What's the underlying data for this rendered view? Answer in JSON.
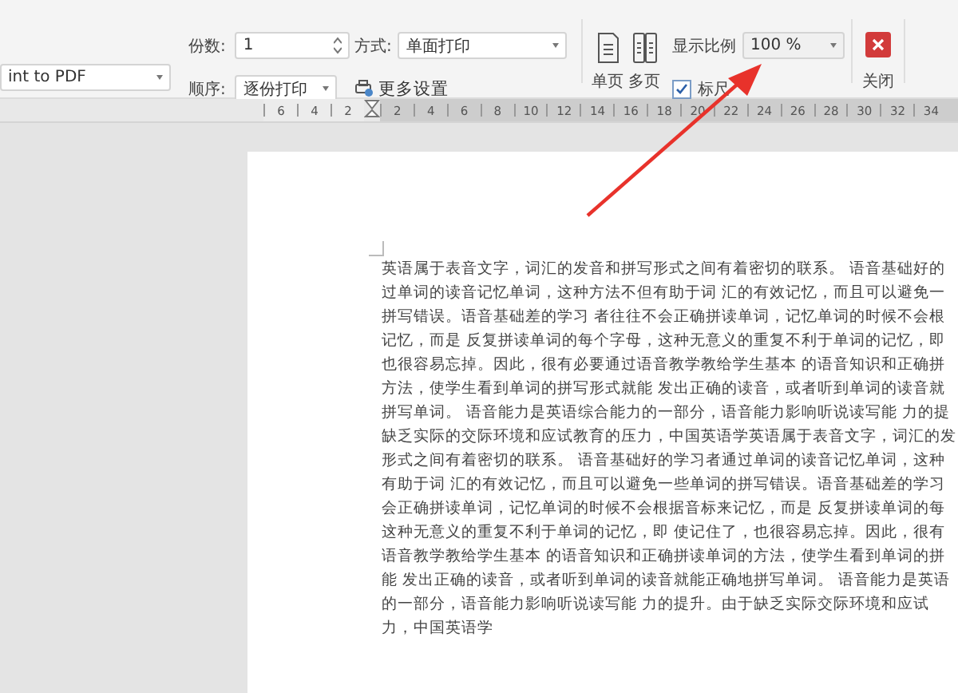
{
  "toolbar": {
    "printer": {
      "value": "int to PDF"
    },
    "copies": {
      "label": "份数:",
      "value": "1"
    },
    "order": {
      "label": "顺序:",
      "value": "逐份打印"
    },
    "mode": {
      "label": "方式:",
      "value": "单面打印"
    },
    "more_settings": "更多设置",
    "view_buttons": [
      {
        "label": "单页"
      },
      {
        "label": "多页"
      }
    ],
    "zoom": {
      "label": "显示比例",
      "value": "100 %"
    },
    "ruler_toggle": {
      "label": "标尺",
      "checked": true
    },
    "close": "关闭"
  },
  "ruler": {
    "left_marks": [
      "6",
      "4",
      "2"
    ],
    "right_marks": [
      "2",
      "4",
      "6",
      "8",
      "10",
      "12",
      "14",
      "16",
      "18",
      "20",
      "22",
      "24",
      "26",
      "28",
      "30",
      "32",
      "34"
    ]
  },
  "document": {
    "lines": [
      "英语属于表音文字，词汇的发音和拼写形式之间有着密切的联系。 语音基础好的",
      "过单词的读音记忆单词，这种方法不但有助于词 汇的有效记忆，而且可以避免一",
      "拼写错误。语音基础差的学习 者往往不会正确拼读单词，记忆单词的时候不会根",
      "记忆，而是 反复拼读单词的每个字母，这种无意义的重复不利于单词的记忆，即",
      "也很容易忘掉。因此，很有必要通过语音教学教给学生基本 的语音知识和正确拼",
      "方法，使学生看到单词的拼写形式就能 发出正确的读音，或者听到单词的读音就",
      "拼写单词。 语音能力是英语综合能力的一部分，语音能力影响听说读写能 力的提",
      "缺乏实际的交际环境和应试教育的压力，中国英语学英语属于表音文字，词汇的发",
      "形式之间有着密切的联系。 语音基础好的学习者通过单词的读音记忆单词，这种",
      "有助于词 汇的有效记忆，而且可以避免一些单词的拼写错误。语音基础差的学习",
      "会正确拼读单词，记忆单词的时候不会根据音标来记忆，而是 反复拼读单词的每",
      "这种无意义的重复不利于单词的记忆，即 使记住了，也很容易忘掉。因此，很有",
      "语音教学教给学生基本 的语音知识和正确拼读单词的方法，使学生看到单词的拼",
      "能 发出正确的读音，或者听到单词的读音就能正确地拼写单词。 语音能力是英语",
      "的一部分，语音能力影响听说读写能 力的提升。由于缺乏实际交际环境和应试",
      "力，中国英语学"
    ]
  }
}
